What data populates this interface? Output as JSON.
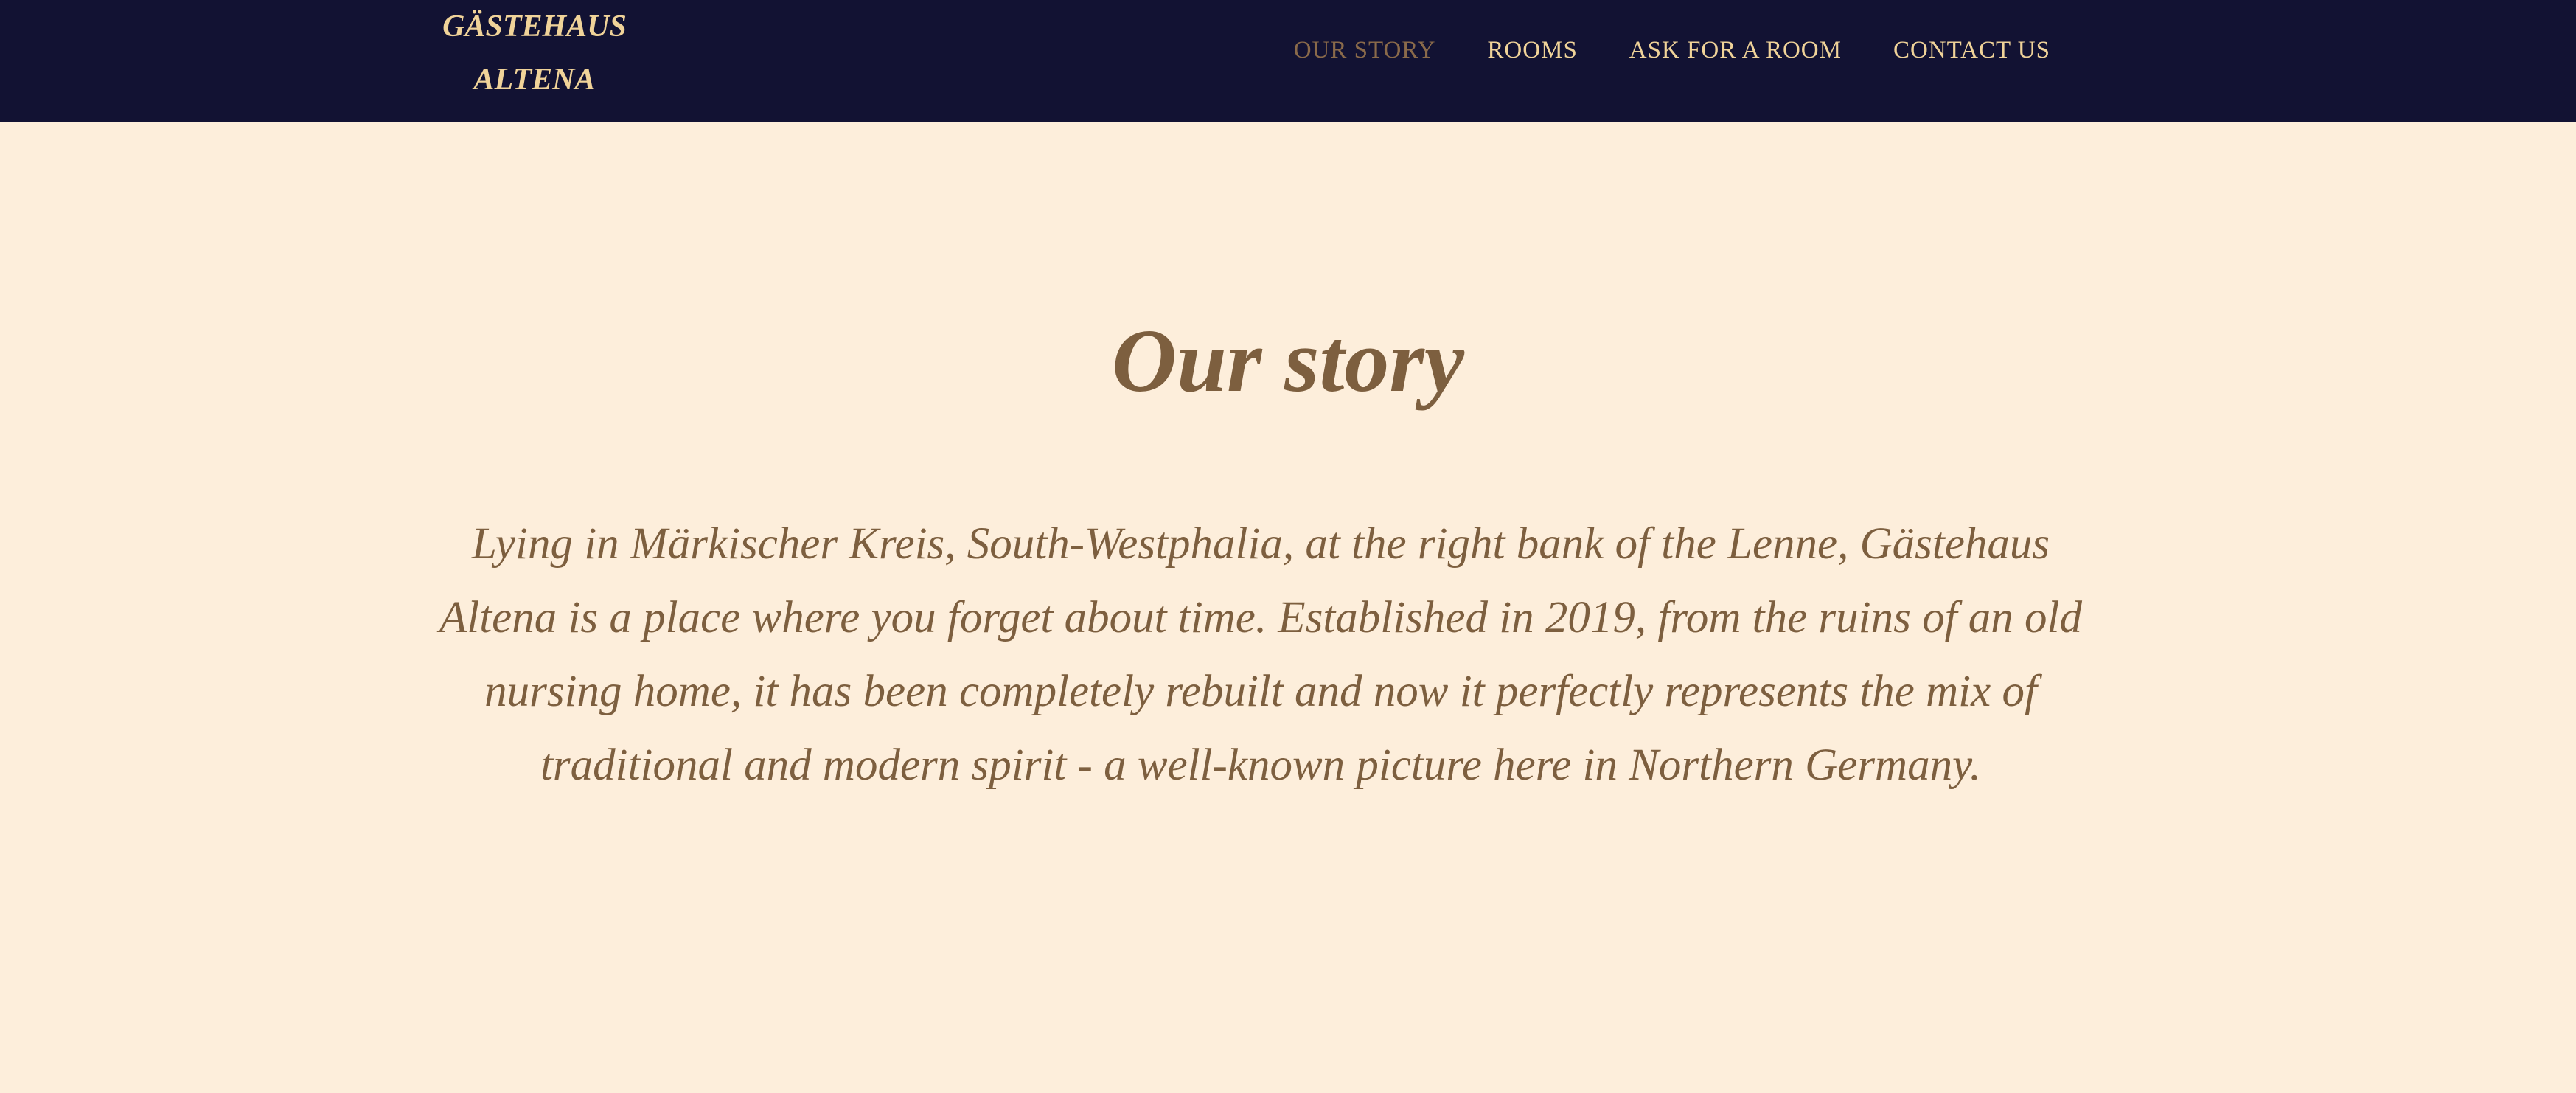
{
  "header": {
    "logo_line1": "GÄSTEHAUS",
    "logo_line2": "ALTENA",
    "nav": [
      {
        "label": "OUR STORY",
        "active": true
      },
      {
        "label": "ROOMS"
      },
      {
        "label": "ASK FOR A ROOM"
      },
      {
        "label": "CONTACT US"
      }
    ]
  },
  "main": {
    "title": "Our story",
    "body": "Lying in Märkischer Kreis, South-Westphalia, at the right bank of the Lenne, Gästehaus Altena is a place where you forget about time. Established in 2019, from the ruins of an old nursing home, it has been completely rebuilt and now it perfectly represents the mix of traditional and modern spirit - a well-known picture here in Northern Germany."
  },
  "colors": {
    "header_bg": "#121233",
    "accent": "#f0d399",
    "text": "#7d5f3f",
    "page_bg": "#fdeedb"
  }
}
